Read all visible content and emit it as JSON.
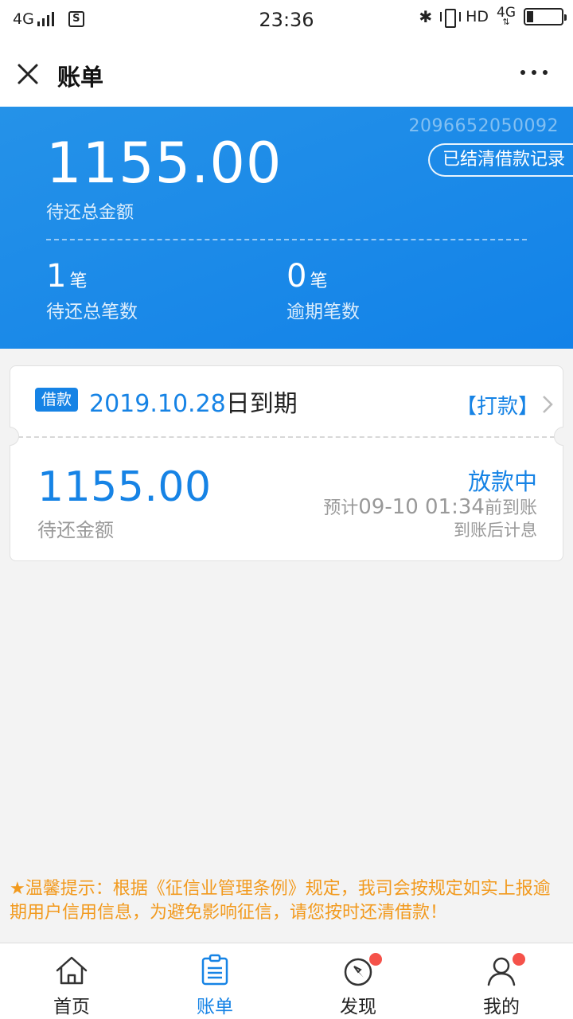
{
  "status_bar": {
    "network": "4G",
    "sim_label": "S",
    "time": "23:36",
    "hd": "HD",
    "net_right": "4G"
  },
  "header": {
    "title": "账单"
  },
  "summary": {
    "order_no": "2096652050092",
    "cleared_button": "已结清借款记录",
    "total_amount": "1155.00",
    "total_label": "待还总金额",
    "count_pending": "1",
    "count_unit": "笔",
    "count_pending_label": "待还总笔数",
    "count_overdue": "0",
    "count_overdue_label": "逾期笔数"
  },
  "loan_card": {
    "tag": "借款",
    "due_date": "2019.10.28",
    "due_suffix": "日到期",
    "transfer_link": "【打款】",
    "amount": "1155.00",
    "amount_label": "待还金额",
    "status": "放款中",
    "eta_prefix": "预计",
    "eta_time": "09-10 01:34",
    "eta_suffix": "前到账",
    "interest_note": "到账后计息"
  },
  "tip": {
    "text": "★温馨提示：根据《征信业管理条例》规定，我司会按规定如实上报逾期用户信用信息，为避免影响征信，请您按时还清借款！"
  },
  "bottom_nav": {
    "items": [
      {
        "label": "首页",
        "icon": "home-icon"
      },
      {
        "label": "账单",
        "icon": "bill-icon",
        "active": true
      },
      {
        "label": "发现",
        "icon": "compass-icon",
        "badge": true
      },
      {
        "label": "我的",
        "icon": "user-icon",
        "badge": true
      }
    ]
  },
  "colors": {
    "primary": "#1683e5",
    "banner": "#1282e8",
    "tip": "#f29a1e",
    "badge": "#f5524a"
  }
}
